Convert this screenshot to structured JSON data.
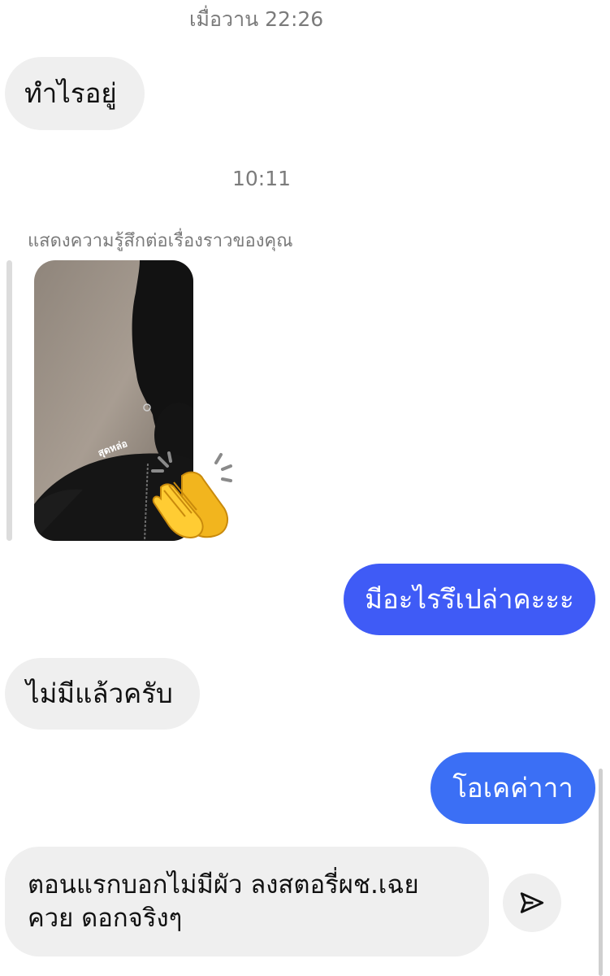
{
  "colors": {
    "outgoing_bubble": "#3f5bf6",
    "outgoing_bubble_alt": "#3b6ff5",
    "incoming_bubble": "#efefef",
    "timestamp": "#7b7b7b"
  },
  "timestamps": {
    "first": "เมื่อวาน 22:26",
    "second": "10:11"
  },
  "messages": {
    "m1": "ทำไรอยู่",
    "story_reply_label": "แสดงความรู้สึกต่อเรื่องราวของคุณ",
    "story_caption": "สุดหล่อ",
    "story_reaction": "clapping-hands",
    "m2": "มีอะไรรึเปล่าคะะะ",
    "m3": "ไม่มีแล้วครับ",
    "m4": "โอเคค่าาา",
    "m5_line1": "ตอนแรกบอกไม่มีผัว ลงสตอรี่ผช.เฉย",
    "m5_line2": "ควย ดอกจริงๆ"
  },
  "icons": {
    "send": "send-icon",
    "reaction": "clap-icon"
  }
}
